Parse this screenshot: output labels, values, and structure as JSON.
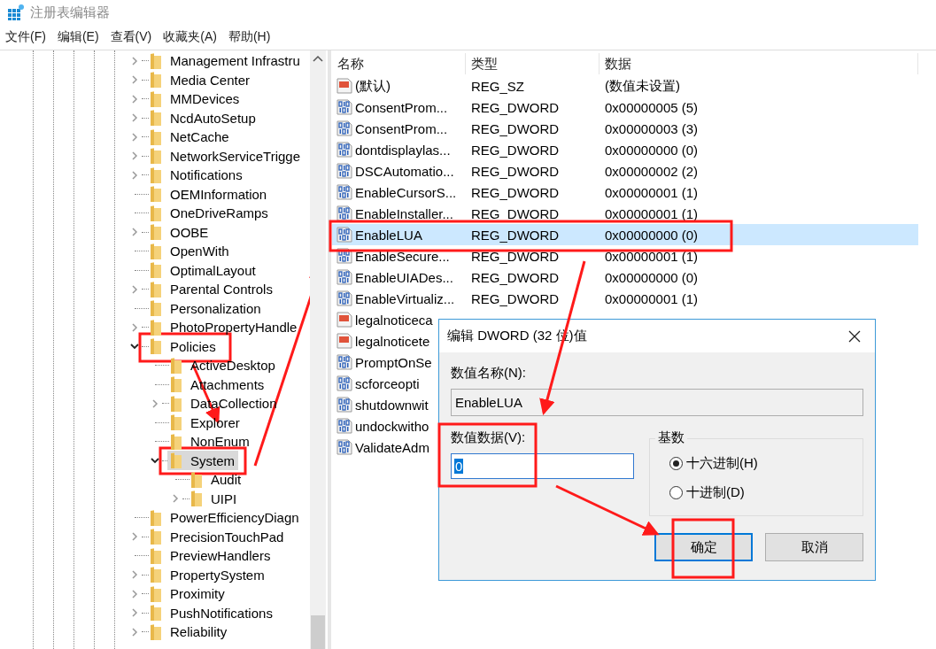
{
  "window": {
    "title": "注册表编辑器"
  },
  "menu": [
    "文件(F)",
    "编辑(E)",
    "查看(V)",
    "收藏夹(A)",
    "帮助(H)"
  ],
  "tree": [
    {
      "label": "Management Infrastru",
      "expanded": false,
      "selected": false
    },
    {
      "label": "Media Center",
      "expanded": false,
      "selected": false
    },
    {
      "label": "MMDevices",
      "expanded": false,
      "selected": false
    },
    {
      "label": "NcdAutoSetup",
      "expanded": false,
      "selected": false
    },
    {
      "label": "NetCache",
      "expanded": false,
      "selected": false
    },
    {
      "label": "NetworkServiceTrigge",
      "expanded": false,
      "selected": false
    },
    {
      "label": "Notifications",
      "expanded": false,
      "selected": false
    },
    {
      "label": "OEMInformation",
      "selected": false
    },
    {
      "label": "OneDriveRamps",
      "selected": false
    },
    {
      "label": "OOBE",
      "expanded": false,
      "selected": false
    },
    {
      "label": "OpenWith",
      "selected": false
    },
    {
      "label": "OptimalLayout",
      "selected": false
    },
    {
      "label": "Parental Controls",
      "expanded": false,
      "selected": false
    },
    {
      "label": "Personalization",
      "selected": false
    },
    {
      "label": "PhotoPropertyHandle",
      "expanded": false,
      "selected": false
    },
    {
      "label": "Policies",
      "expanded": true,
      "selected": false,
      "children": [
        {
          "label": "ActiveDesktop",
          "selected": false
        },
        {
          "label": "Attachments",
          "selected": false
        },
        {
          "label": "DataCollection",
          "expanded": false,
          "selected": false
        },
        {
          "label": "Explorer",
          "selected": false
        },
        {
          "label": "NonEnum",
          "selected": false
        },
        {
          "label": "System",
          "expanded": true,
          "selected": true,
          "children": [
            {
              "label": "Audit",
              "selected": false
            },
            {
              "label": "UIPI",
              "expanded": false,
              "selected": false
            }
          ]
        }
      ]
    },
    {
      "label": "PowerEfficiencyDiagn",
      "selected": false
    },
    {
      "label": "PrecisionTouchPad",
      "expanded": false,
      "selected": false
    },
    {
      "label": "PreviewHandlers",
      "selected": false
    },
    {
      "label": "PropertySystem",
      "expanded": false,
      "selected": false
    },
    {
      "label": "Proximity",
      "expanded": false,
      "selected": false
    },
    {
      "label": "PushNotifications",
      "expanded": false,
      "selected": false
    },
    {
      "label": "Reliability",
      "expanded": false,
      "selected": false
    }
  ],
  "values": {
    "columns": [
      "名称",
      "类型",
      "数据"
    ],
    "rows": [
      {
        "kind": "string",
        "name": "(默认)",
        "type": "REG_SZ",
        "data": "(数值未设置)",
        "selected": false
      },
      {
        "kind": "dword",
        "name": "ConsentProm...",
        "type": "REG_DWORD",
        "data": "0x00000005 (5)",
        "selected": false
      },
      {
        "kind": "dword",
        "name": "ConsentProm...",
        "type": "REG_DWORD",
        "data": "0x00000003 (3)",
        "selected": false
      },
      {
        "kind": "dword",
        "name": "dontdisplaylas...",
        "type": "REG_DWORD",
        "data": "0x00000000 (0)",
        "selected": false
      },
      {
        "kind": "dword",
        "name": "DSCAutomatio...",
        "type": "REG_DWORD",
        "data": "0x00000002 (2)",
        "selected": false
      },
      {
        "kind": "dword",
        "name": "EnableCursorS...",
        "type": "REG_DWORD",
        "data": "0x00000001 (1)",
        "selected": false
      },
      {
        "kind": "dword",
        "name": "EnableInstaller...",
        "type": "REG_DWORD",
        "data": "0x00000001 (1)",
        "selected": false
      },
      {
        "kind": "dword",
        "name": "EnableLUA",
        "type": "REG_DWORD",
        "data": "0x00000000 (0)",
        "selected": true
      },
      {
        "kind": "dword",
        "name": "EnableSecure...",
        "type": "REG_DWORD",
        "data": "0x00000001 (1)",
        "selected": false
      },
      {
        "kind": "dword",
        "name": "EnableUIADes...",
        "type": "REG_DWORD",
        "data": "0x00000000 (0)",
        "selected": false
      },
      {
        "kind": "dword",
        "name": "EnableVirtualiz...",
        "type": "REG_DWORD",
        "data": "0x00000001 (1)",
        "selected": false
      },
      {
        "kind": "string",
        "name": "legalnoticeca",
        "selected": false
      },
      {
        "kind": "string",
        "name": "legalnoticete",
        "selected": false
      },
      {
        "kind": "dword",
        "name": "PromptOnSe",
        "selected": false
      },
      {
        "kind": "dword",
        "name": "scforceopti",
        "selected": false
      },
      {
        "kind": "dword",
        "name": "shutdownwit",
        "selected": false
      },
      {
        "kind": "dword",
        "name": "undockwitho",
        "selected": false
      },
      {
        "kind": "dword",
        "name": "ValidateAdm",
        "selected": false
      }
    ]
  },
  "dialog": {
    "title": "编辑 DWORD (32 位)值",
    "name_label": "数值名称(N):",
    "name_value": "EnableLUA",
    "data_label": "数值数据(V):",
    "data_value": "0",
    "base_label": "基数",
    "radios": [
      {
        "label": "十六进制(H)",
        "selected": true
      },
      {
        "label": "十进制(D)",
        "selected": false
      }
    ],
    "buttons": [
      {
        "label": "确定",
        "default": true
      },
      {
        "label": "取消",
        "default": false
      }
    ]
  }
}
